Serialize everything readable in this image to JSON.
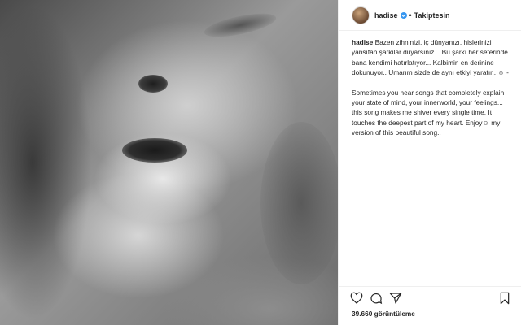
{
  "post": {
    "username": "hadise",
    "follow_state": "Takiptesin",
    "separator": "•",
    "caption_tr": "Bazen zihninizi, iç dünyanızı, hislerinizi yansıtan şarkılar duyarsınız... Bu şarkı her seferinde bana kendimi hatırlatıyor... Kalbimin en derinine dokunuyor.. Umarım sizde de aynı etkiyi yaratır.. ☺ -",
    "caption_en": "Sometimes you hear songs that completely explain your state of mind, your innerworld, your feelings... this song makes me shiver every single time. It touches the deepest part of my heart. Enjoy☺ my version of this beautiful song..",
    "views": "39.660 görüntüleme"
  },
  "icons": {
    "verified": "verified-badge-icon",
    "like": "heart-icon",
    "comment": "comment-icon",
    "share": "share-icon",
    "save": "bookmark-icon"
  },
  "colors": {
    "verified": "#3897f0",
    "text": "#262626",
    "border": "#efefef"
  }
}
